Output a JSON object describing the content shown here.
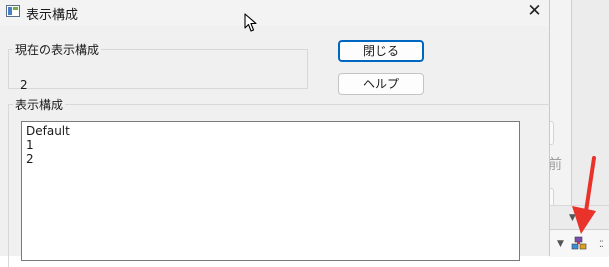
{
  "window": {
    "title": "表示構成",
    "close_glyph": "✕"
  },
  "current_config": {
    "legend": "現在の表示構成",
    "value": "2"
  },
  "buttons": {
    "close_label": "閉じる",
    "help_label": "ヘルプ"
  },
  "config_group": {
    "legend": "表示構成",
    "items": [
      "Default",
      "1",
      "2"
    ]
  },
  "background_app": {
    "partial_text": "名前"
  },
  "colors": {
    "focus_border": "#0067c0",
    "annotation_arrow": "#e8322a"
  }
}
